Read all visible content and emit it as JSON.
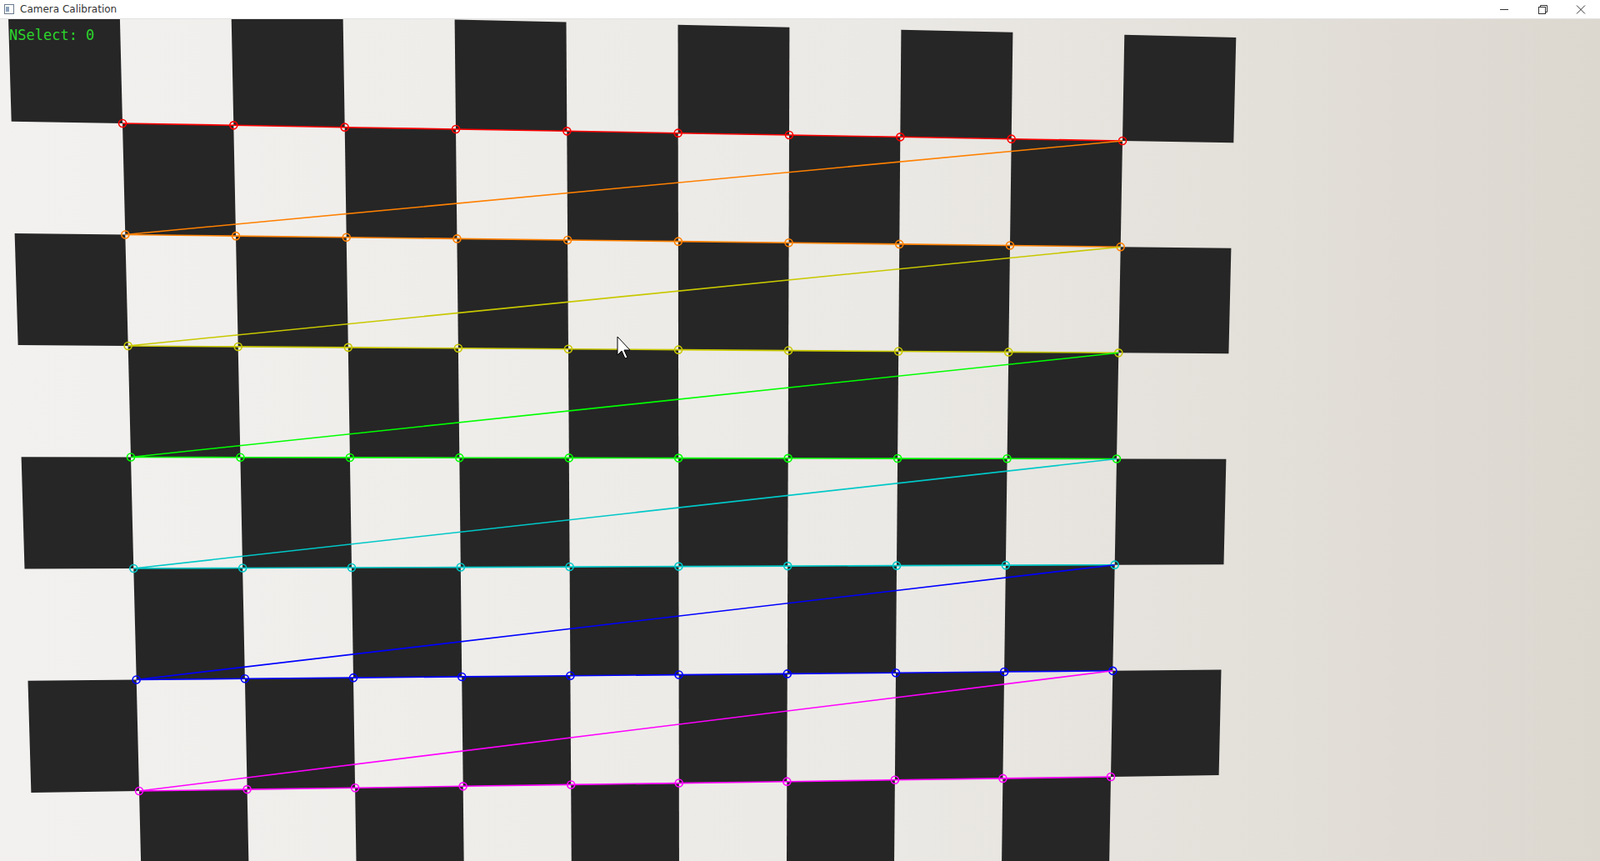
{
  "window": {
    "title": "Camera Calibration"
  },
  "overlay": {
    "text": "NSelect: 0"
  },
  "pattern": {
    "corners_per_row": 10
  },
  "corner_rows": [
    {
      "color": "#ff0000"
    },
    {
      "color": "#ff8000"
    },
    {
      "color": "#c8c800"
    },
    {
      "color": "#00ff00"
    },
    {
      "color": "#00c8c8"
    },
    {
      "color": "#0000ff"
    },
    {
      "color": "#ff00ff"
    }
  ]
}
